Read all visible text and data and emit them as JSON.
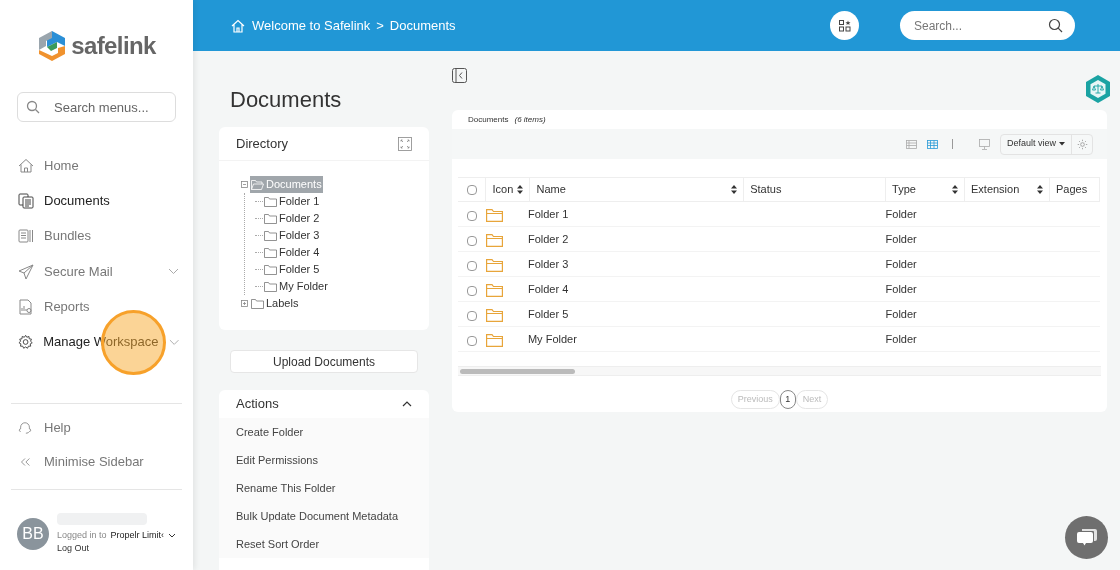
{
  "sidebar": {
    "logo": "safelink",
    "search": {
      "placeholder": "Search menus..."
    },
    "items": [
      {
        "label": "Home",
        "selected": false,
        "expandable": false,
        "click_target": false
      },
      {
        "label": "Documents",
        "selected": true,
        "expandable": false,
        "click_target": false
      },
      {
        "label": "Bundles",
        "selected": false,
        "expandable": false,
        "click_target": false
      },
      {
        "label": "Secure Mail",
        "selected": false,
        "expandable": true,
        "click_target": false
      },
      {
        "label": "Reports",
        "selected": false,
        "expandable": false,
        "click_target": false
      },
      {
        "label": "Manage Workspace",
        "selected": true,
        "expandable": true,
        "click_target": true
      }
    ],
    "footer_items": [
      {
        "label": "Help"
      },
      {
        "label": "Minimise Sidebar"
      }
    ],
    "user": {
      "initials": "BB",
      "logged_in_label": "Logged in to",
      "organisation": "Propelr Limit‹",
      "logout": "Log Out"
    }
  },
  "header": {
    "breadcrumb": [
      "Welcome to Safelink",
      "Documents"
    ],
    "breadcrumb_separator": ">",
    "search": {
      "placeholder": "Search..."
    }
  },
  "page_title": "Documents",
  "directory": {
    "title": "Directory",
    "tree": [
      {
        "label": "Documents",
        "selected": true,
        "expanded": true,
        "children": [
          {
            "label": "Folder 1",
            "selected": false
          },
          {
            "label": "Folder 2",
            "selected": false
          },
          {
            "label": "Folder 3",
            "selected": false
          },
          {
            "label": "Folder 4",
            "selected": false
          },
          {
            "label": "Folder 5",
            "selected": false
          },
          {
            "label": "My Folder",
            "selected": false
          }
        ]
      },
      {
        "label": "Labels",
        "selected": false,
        "expanded": false
      }
    ]
  },
  "upload_button": "Upload Documents",
  "actions": {
    "title": "Actions",
    "expanded": true,
    "items": [
      "Create Folder",
      "Edit Permissions",
      "Rename This Folder",
      "Bulk Update Document Metadata",
      "Reset Sort Order"
    ]
  },
  "documents": {
    "heading": "Documents",
    "count": "(6 items)",
    "select_all": {
      "checked": false
    },
    "view_modes": [
      {
        "selected": false
      },
      {
        "selected": true
      },
      {
        "selected": false
      }
    ],
    "view_select": "Default view",
    "columns": [
      {
        "label": "Icon",
        "sortable": true
      },
      {
        "label": "Name",
        "sortable": true
      },
      {
        "label": "Status",
        "sortable": false
      },
      {
        "label": "Type",
        "sortable": true
      },
      {
        "label": "Extension",
        "sortable": true
      },
      {
        "label": "Pages",
        "sortable": false
      }
    ],
    "rows": [
      {
        "name": "Folder 1",
        "type": "Folder",
        "checked": false
      },
      {
        "name": "Folder 2",
        "type": "Folder",
        "checked": false
      },
      {
        "name": "Folder 3",
        "type": "Folder",
        "checked": false
      },
      {
        "name": "Folder 4",
        "type": "Folder",
        "checked": false
      },
      {
        "name": "Folder 5",
        "type": "Folder",
        "checked": false
      },
      {
        "name": "My Folder",
        "type": "Folder",
        "checked": false
      }
    ],
    "pagination": {
      "previous": "Previous",
      "pages": [
        {
          "label": "1",
          "selected": true
        }
      ],
      "next": "Next"
    }
  }
}
